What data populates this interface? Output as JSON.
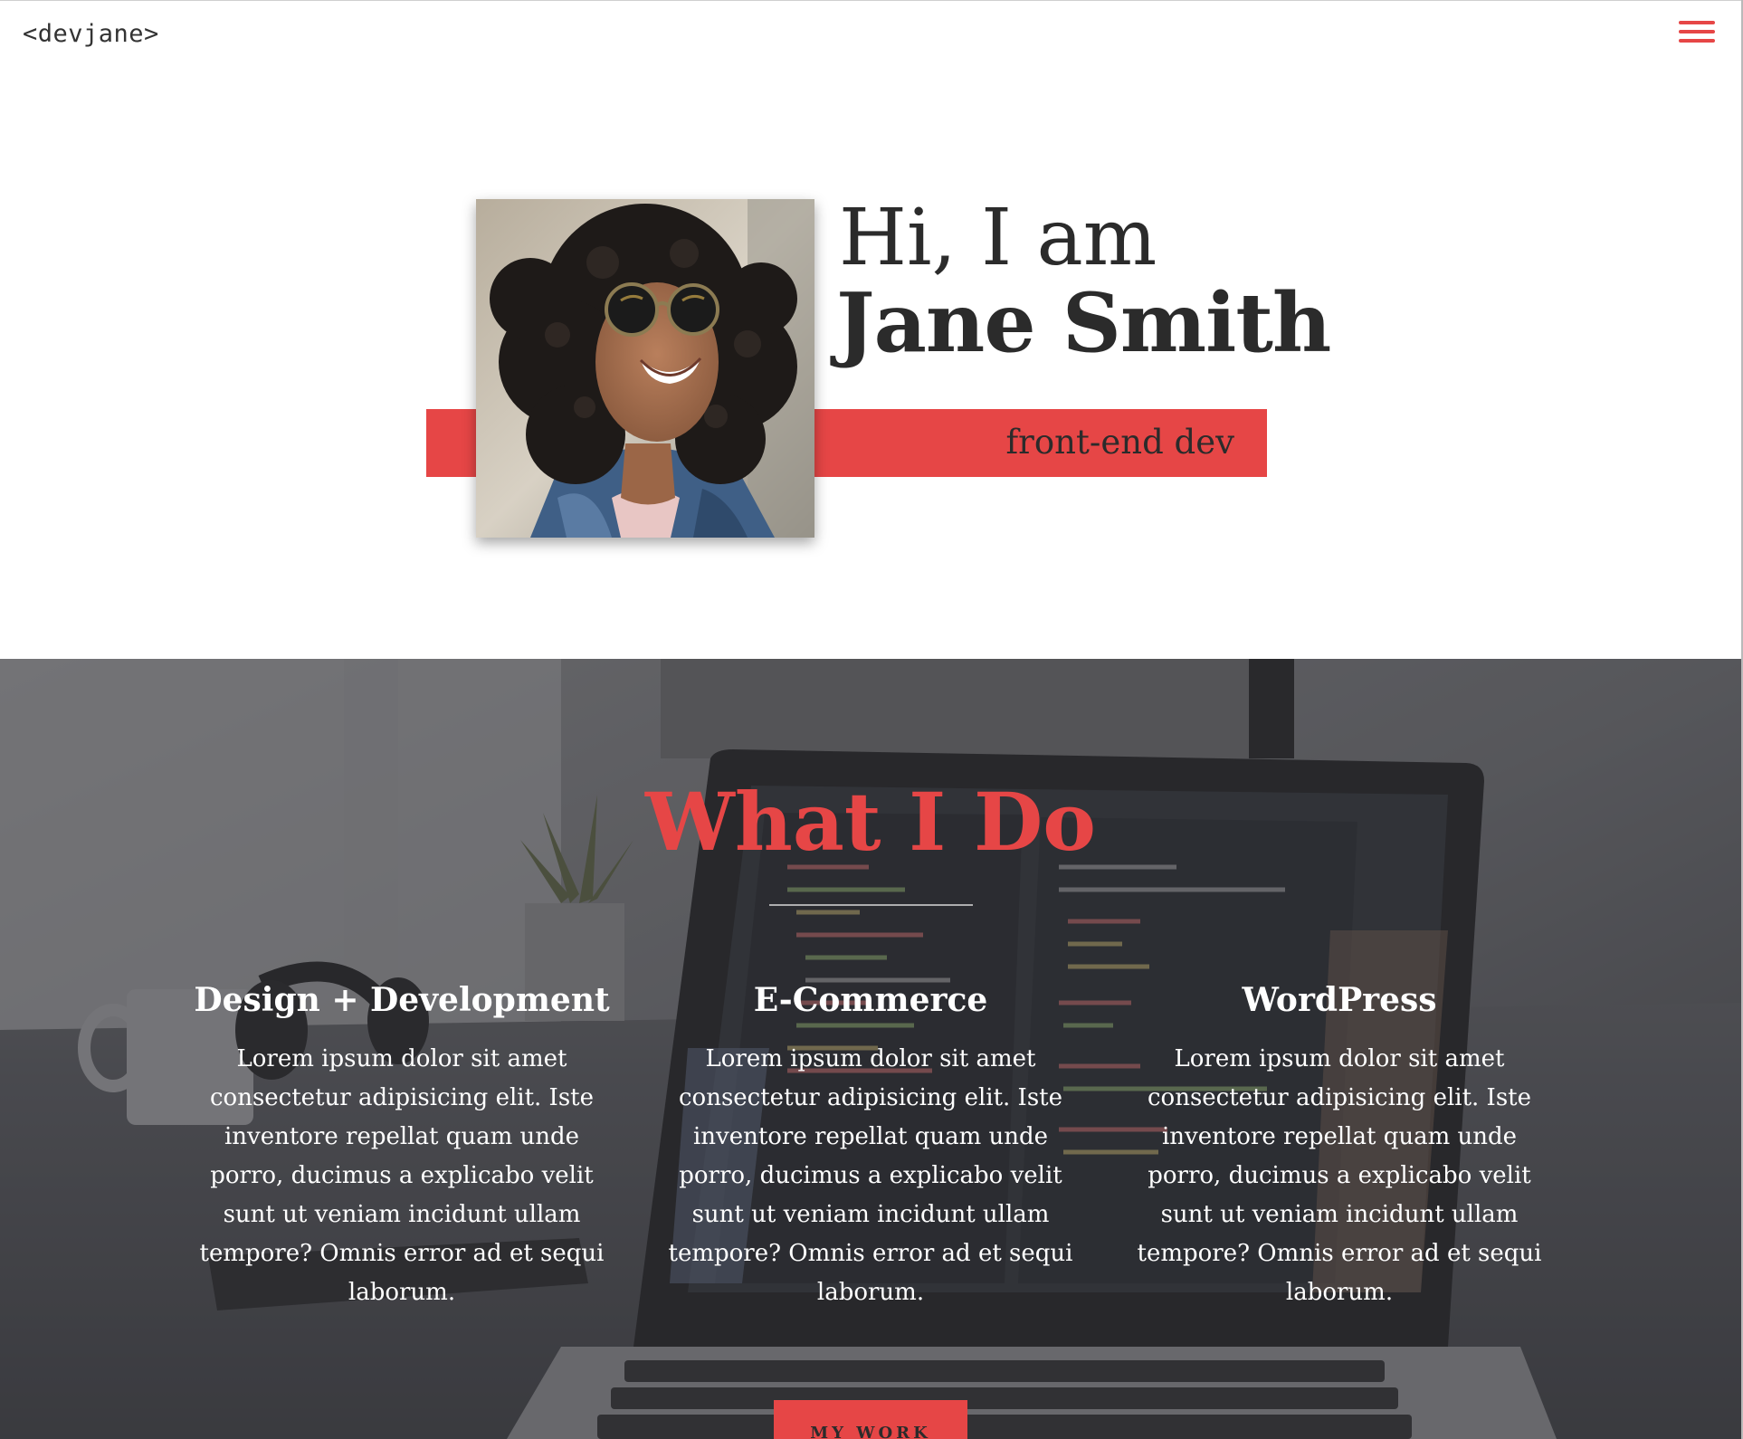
{
  "header": {
    "logo": "<devjane>",
    "menu_icon": "hamburger-menu-icon"
  },
  "hero": {
    "greeting": "Hi, I am",
    "name": "Jane Smith",
    "subtitle": "front-end dev",
    "portrait": "portrait-photo"
  },
  "services": {
    "title": "What I Do",
    "background": "laptop-desk-photo",
    "items": [
      {
        "heading": "Design + Development",
        "body": "Lorem ipsum dolor sit amet consectetur adipisicing elit. Iste inventore repellat quam unde porro, ducimus a explicabo velit sunt ut veniam incidunt ullam tempore? Omnis error ad et sequi laborum."
      },
      {
        "heading": "E-Commerce",
        "body": "Lorem ipsum dolor sit amet consectetur adipisicing elit. Iste inventore repellat quam unde porro, ducimus a explicabo velit sunt ut veniam incidunt ullam tempore? Omnis error ad et sequi laborum."
      },
      {
        "heading": "WordPress",
        "body": "Lorem ipsum dolor sit amet consectetur adipisicing elit. Iste inventore repellat quam unde porro, ducimus a explicabo velit sunt ut veniam incidunt ullam tempore? Omnis error ad et sequi laborum."
      }
    ],
    "button_label": "MY WORK"
  },
  "colors": {
    "accent": "#e64646",
    "text": "#2b2b2b",
    "background": "#ffffff"
  }
}
